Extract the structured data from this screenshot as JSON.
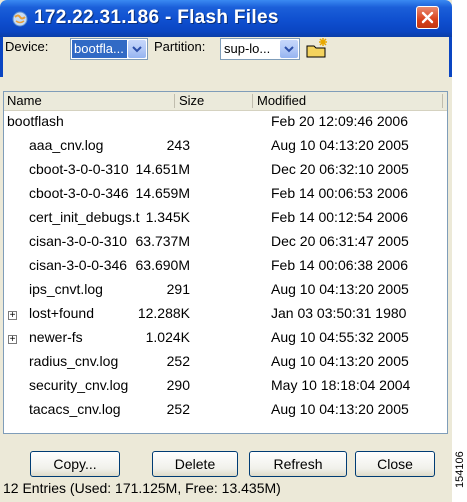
{
  "window": {
    "title": "172.22.31.186 - Flash Files",
    "icon": "globe-icon",
    "close": "close-icon"
  },
  "toolbar": {
    "device_label": "Device:",
    "device_value": "bootfla...",
    "partition_label": "Partition:",
    "partition_value": "sup-lo...",
    "new_folder_icon": "new-folder-icon"
  },
  "list": {
    "columns": [
      "Name",
      "Size",
      "Modified"
    ],
    "root": {
      "name": "bootflash",
      "size": "",
      "modified": "Feb 20 12:09:46 2006"
    },
    "rows": [
      {
        "name": "aaa_cnv.log",
        "size": "243",
        "modified": "Aug 10 04:13:20 2005",
        "expandable": false
      },
      {
        "name": "cboot-3-0-0-310",
        "size": "14.651M",
        "modified": "Dec 20 06:32:10 2005",
        "expandable": false
      },
      {
        "name": "cboot-3-0-0-346",
        "size": "14.659M",
        "modified": "Feb 14 00:06:53 2006",
        "expandable": false
      },
      {
        "name": "cert_init_debugs.t",
        "size": "1.345K",
        "modified": "Feb 14 00:12:54 2006",
        "expandable": false
      },
      {
        "name": "cisan-3-0-0-310",
        "size": "63.737M",
        "modified": "Dec 20 06:31:47 2005",
        "expandable": false
      },
      {
        "name": "cisan-3-0-0-346",
        "size": "63.690M",
        "modified": "Feb 14 00:06:38 2006",
        "expandable": false
      },
      {
        "name": "ips_cnvt.log",
        "size": "291",
        "modified": "Aug 10 04:13:20 2005",
        "expandable": false
      },
      {
        "name": "lost+found",
        "size": "12.288K",
        "modified": "Jan 03 03:50:31 1980",
        "expandable": true
      },
      {
        "name": "newer-fs",
        "size": "1.024K",
        "modified": "Aug 10 04:55:32 2005",
        "expandable": true
      },
      {
        "name": "radius_cnv.log",
        "size": "252",
        "modified": "Aug 10 04:13:20 2005",
        "expandable": false
      },
      {
        "name": "security_cnv.log",
        "size": "290",
        "modified": "May 10 18:18:04 2004",
        "expandable": false
      },
      {
        "name": "tacacs_cnv.log",
        "size": "252",
        "modified": "Aug 10 04:13:20 2005",
        "expandable": false
      }
    ]
  },
  "buttons": {
    "copy": "Copy...",
    "delete": "Delete",
    "refresh": "Refresh",
    "close": "Close"
  },
  "status": "12 Entries (Used: 171.125M, Free: 13.435M)",
  "side_id": "154106",
  "colors": {
    "titlebar": "#0a45c2",
    "selection": "#316ac5",
    "close_button": "#d9421c"
  }
}
